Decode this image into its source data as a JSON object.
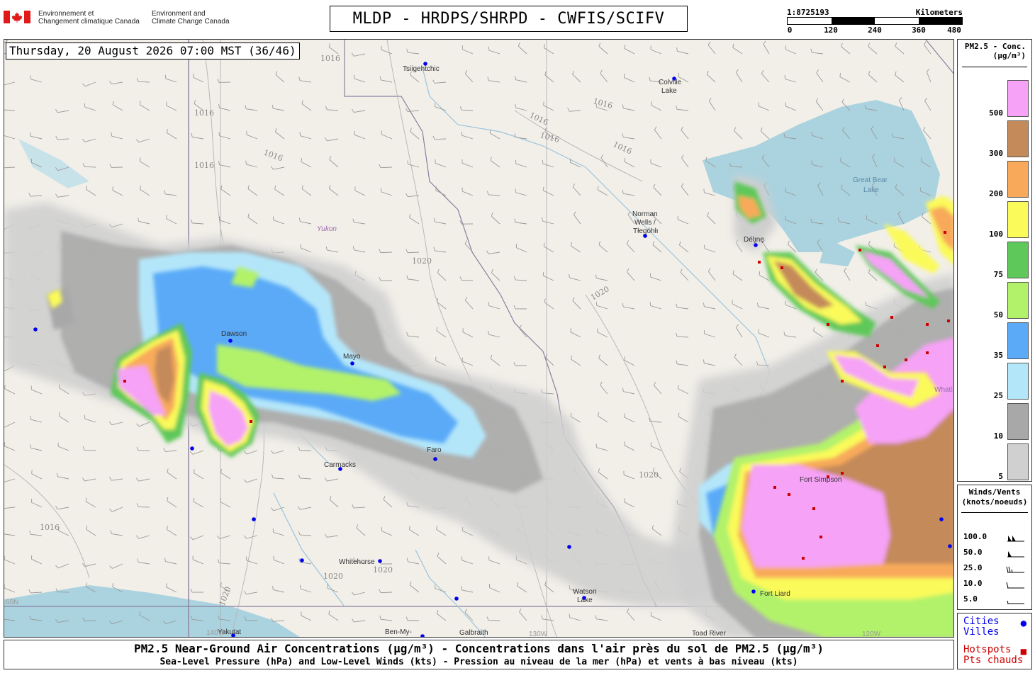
{
  "header": {
    "gov_fr": [
      "Environnement et",
      "Changement climatique Canada"
    ],
    "gov_en": [
      "Environment and",
      "Climate Change Canada"
    ],
    "title": "MLDP - HRDPS/SHRPD - CWFIS/SCIFV"
  },
  "scale": {
    "ratio": "1:8725193",
    "unit": "Kilometers",
    "ticks": [
      "0",
      "120",
      "240",
      "360",
      "480"
    ]
  },
  "map": {
    "timestamp": "Thursday, 20 August 2026 07:00 MST (36/46)",
    "places": [
      {
        "name": "Tsiigehtchic"
      },
      {
        "name": "Colville"
      },
      {
        "name": "Lake"
      },
      {
        "name": "Great Bear"
      },
      {
        "name": "Lake"
      },
      {
        "name": "Norman"
      },
      {
        "name": "Wells /"
      },
      {
        "name": "Tłegóhłı"
      },
      {
        "name": "Délı̨nę"
      },
      {
        "name": "Yukon"
      },
      {
        "name": "Dawson"
      },
      {
        "name": "Mayo"
      },
      {
        "name": "Carmacks"
      },
      {
        "name": "Whitehorse"
      },
      {
        "name": "Watson"
      },
      {
        "name": "Lake"
      },
      {
        "name": "Fort Simpson"
      },
      {
        "name": "Fort Liard"
      },
      {
        "name": "Yakutat"
      },
      {
        "name": "Ben-My-"
      },
      {
        "name": "Galbraith"
      },
      {
        "name": "Toad River"
      },
      {
        "name": "Whatì"
      },
      {
        "name": "Faro"
      }
    ],
    "grid_labels": [
      "60N",
      "140W",
      "130W",
      "120W"
    ],
    "isobar_labels": [
      "1016",
      "1020"
    ]
  },
  "legend": {
    "title_line1": "PM2.5 - Conc.",
    "title_line2": "(μg/m³)",
    "entries": [
      {
        "label": "500",
        "color": "#f6a2f6"
      },
      {
        "label": "300",
        "color": "#c48a5a"
      },
      {
        "label": "200",
        "color": "#f8aa5a"
      },
      {
        "label": "100",
        "color": "#fafa5a"
      },
      {
        "label": "75",
        "color": "#5ec85a"
      },
      {
        "label": "50",
        "color": "#b2f26a"
      },
      {
        "label": "35",
        "color": "#5aaaf8"
      },
      {
        "label": "25",
        "color": "#b4e6fa"
      },
      {
        "label": "10",
        "color": "#a8a8a8"
      },
      {
        "label": "5",
        "color": "#d0d0d0"
      }
    ]
  },
  "winds": {
    "title_line1": "Winds/Vents",
    "title_line2": "(knots/noeuds)",
    "rows": [
      {
        "label": "100.0",
        "knots": 100
      },
      {
        "label": "50.0",
        "knots": 50
      },
      {
        "label": "25.0",
        "knots": 25
      },
      {
        "label": "10.0",
        "knots": 10
      },
      {
        "label": "5.0",
        "knots": 5
      }
    ]
  },
  "cities": {
    "cities_en": "Cities",
    "cities_fr": "Villes",
    "hotspots_en": "Hotspots",
    "hotspots_fr": "Pts chauds",
    "city_color": "#0000ee",
    "hotspot_color": "#cc0000"
  },
  "footer": {
    "line1": "PM2.5 Near-Ground Air Concentrations (μg/m³) - Concentrations dans l'air près du sol de PM2.5 (μg/m³)",
    "line2": "Sea-Level Pressure (hPa) and Low-Level Winds (kts) - Pression au niveau de la mer (hPa) et vents à bas niveau (kts)"
  }
}
